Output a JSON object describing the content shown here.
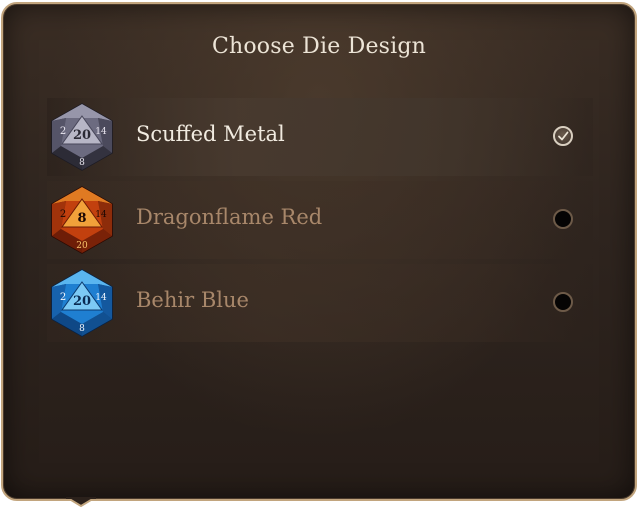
{
  "dialog": {
    "title": "Choose Die Design",
    "options": [
      {
        "label": "Scuffed Metal",
        "selected": true,
        "icon": "d20-metal-icon",
        "die_face_number": "20",
        "die_numbers": [
          "2",
          "8",
          "14"
        ],
        "colors": {
          "dark": "#3b3a48",
          "mid": "#6c6b80",
          "light": "#b7b6c6",
          "numbers": "#e9e6f0"
        }
      },
      {
        "label": "Dragonflame Red",
        "selected": false,
        "icon": "d20-dragonflame-icon",
        "die_face_number": "8",
        "die_numbers": [
          "2",
          "14",
          "20"
        ],
        "colors": {
          "dark": "#5a1206",
          "mid": "#c2400e",
          "light": "#f1a13a",
          "numbers": "#1a0804"
        }
      },
      {
        "label": "Behir Blue",
        "selected": false,
        "icon": "d20-blue-icon",
        "die_face_number": "20",
        "die_numbers": [
          "2",
          "8",
          "14"
        ],
        "colors": {
          "dark": "#0d3f7a",
          "mid": "#1f7fd1",
          "light": "#7cc9f5",
          "numbers": "#f2f8ff"
        }
      }
    ]
  },
  "colors": {
    "border": "#c2a57e",
    "panel_bg": "#2f251f",
    "selected_text": "#f1ebe0",
    "unselected_text": "#a8876a"
  }
}
